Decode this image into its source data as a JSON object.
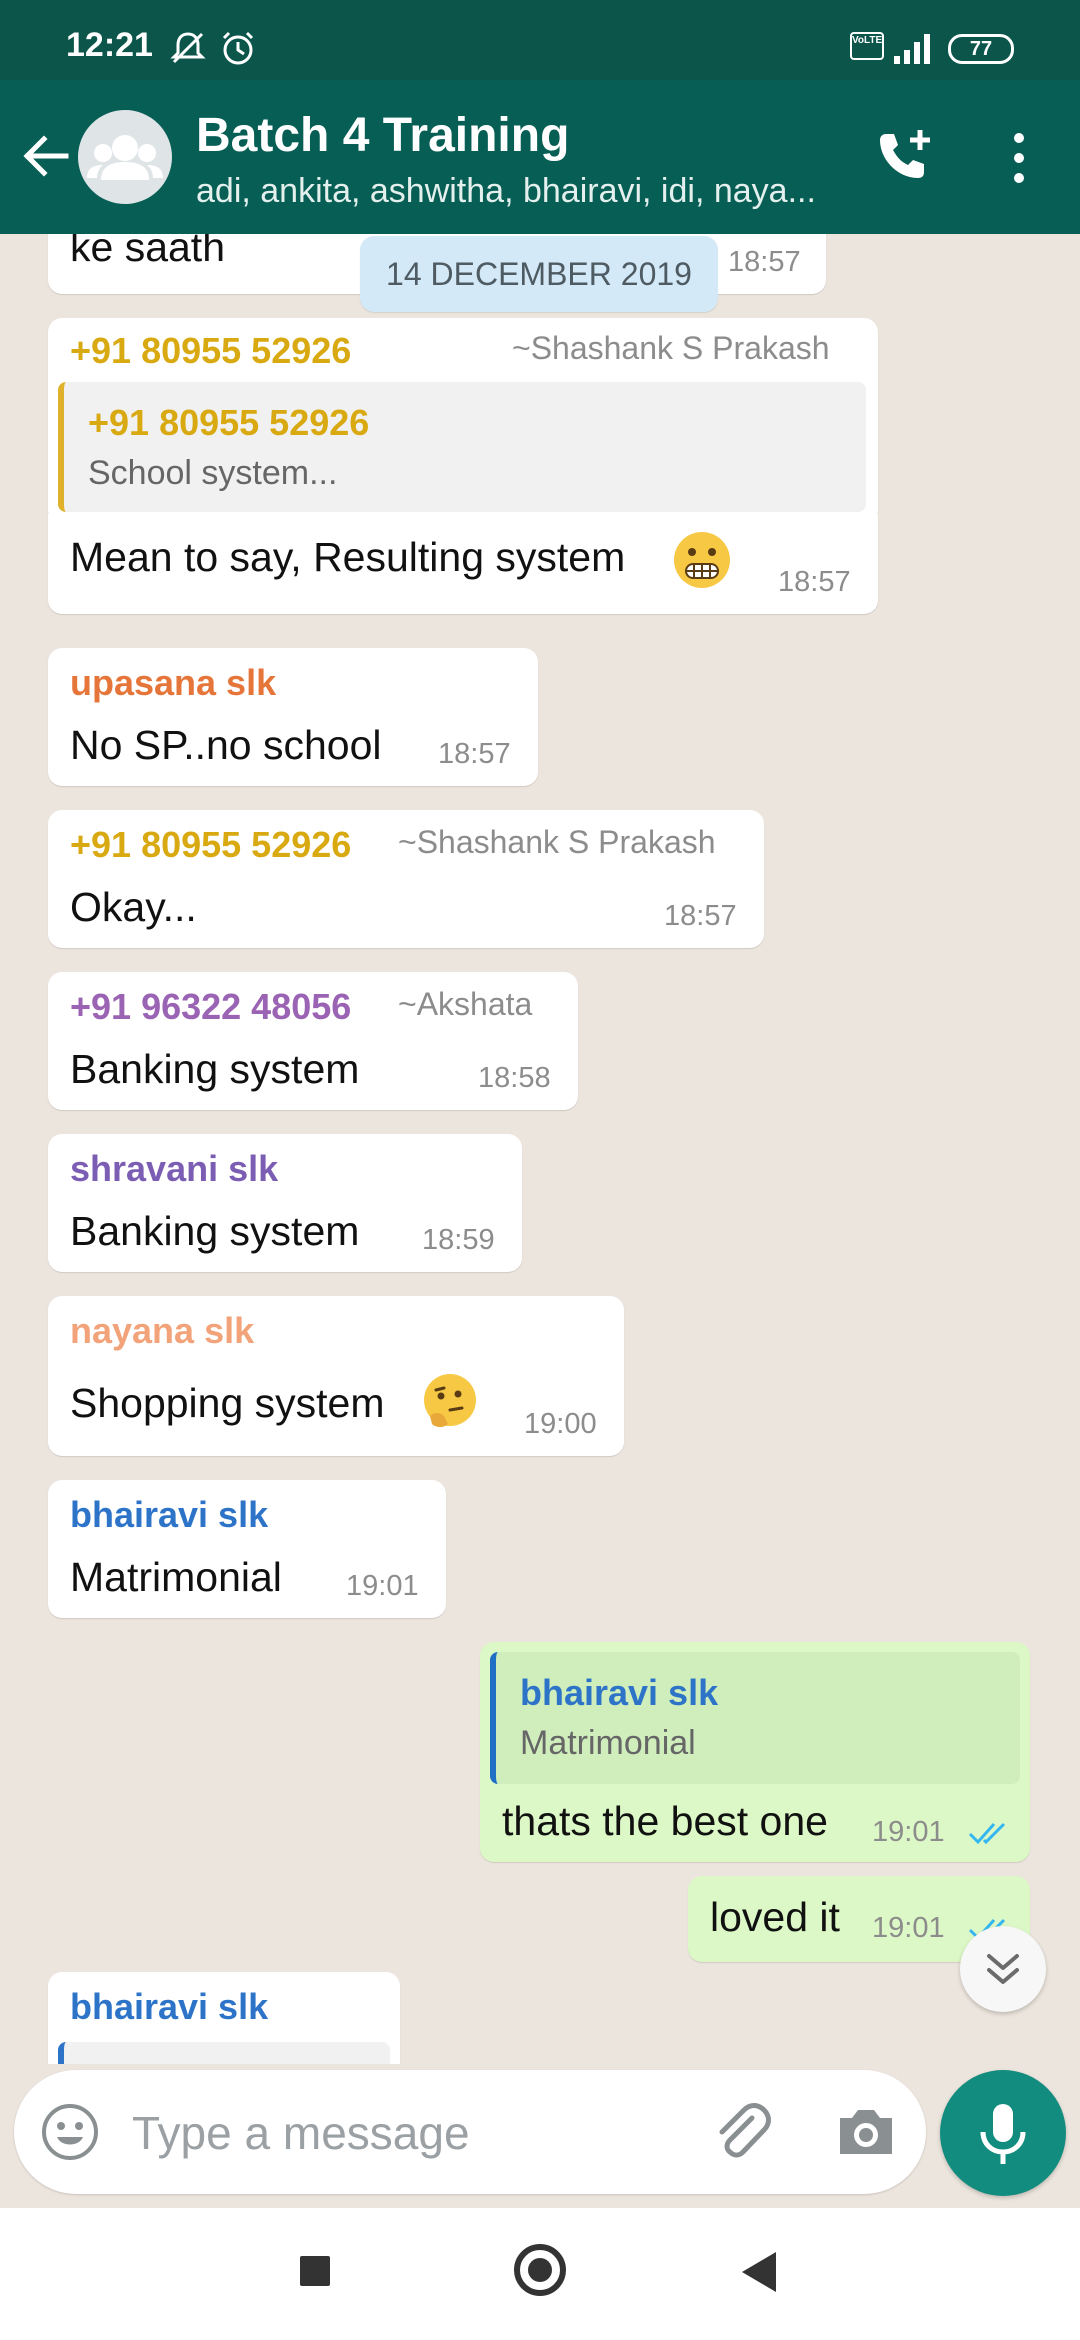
{
  "status_bar": {
    "time": "12:21",
    "battery": "77",
    "network": "VoLTE"
  },
  "header": {
    "title": "Batch 4 Training",
    "members": "adi, ankita, ashwitha, bhairavi, idi, naya..."
  },
  "colors": {
    "header": "#075e54",
    "status_bar": "#0b554b",
    "incoming_bubble": "#ffffff",
    "outgoing_bubble": "#dcf8c6",
    "sender_yellow": "#d9a911",
    "sender_orange": "#e6753a",
    "sender_purple": "#9a63b3",
    "sender_violet": "#7b5db3",
    "sender_peach": "#f2a37a",
    "sender_blue": "#2d74c9",
    "tick_blue": "#34b7f1",
    "mic_button": "#128c7e"
  },
  "chat": {
    "date_chip": "14 DECEMBER 2019",
    "messages": [
      {
        "text": "ke saath",
        "time": "18:57"
      },
      {
        "sender": "+91 80955 52926",
        "alias": "~Shashank S Prakash",
        "quote_sender": "+91 80955 52926",
        "quote_text": "School system...",
        "text": "Mean to say, Resulting system",
        "emoji": "grimacing-face",
        "time": "18:57"
      },
      {
        "sender": "upasana slk",
        "text": "No SP..no school",
        "time": "18:57"
      },
      {
        "sender": "+91 80955 52926",
        "alias": "~Shashank S Prakash",
        "text": "Okay...",
        "time": "18:57"
      },
      {
        "sender": "+91 96322 48056",
        "alias": "~Akshata",
        "text": "Banking system",
        "time": "18:58"
      },
      {
        "sender": "shravani slk",
        "text": "Banking system",
        "time": "18:59"
      },
      {
        "sender": "nayana slk",
        "text": "Shopping system",
        "emoji": "thinking-face",
        "time": "19:00"
      },
      {
        "sender": "bhairavi slk",
        "text": "Matrimonial",
        "time": "19:01"
      },
      {
        "quote_sender": "bhairavi slk",
        "quote_text": "Matrimonial",
        "text": "thats the best one",
        "time": "19:01",
        "status": "read"
      },
      {
        "text": "loved it",
        "time": "19:01",
        "status": "read"
      },
      {
        "sender": "bhairavi slk"
      }
    ]
  },
  "composer": {
    "placeholder": "Type a message"
  },
  "icons": {
    "back": "arrow-left-icon",
    "avatar": "group-avatar-icon",
    "call": "add-call-icon",
    "menu": "more-vert-icon",
    "emoji": "smiley-icon",
    "attach": "paperclip-icon",
    "camera": "camera-icon",
    "mic": "microphone-icon",
    "scroll": "double-chevron-down-icon"
  }
}
